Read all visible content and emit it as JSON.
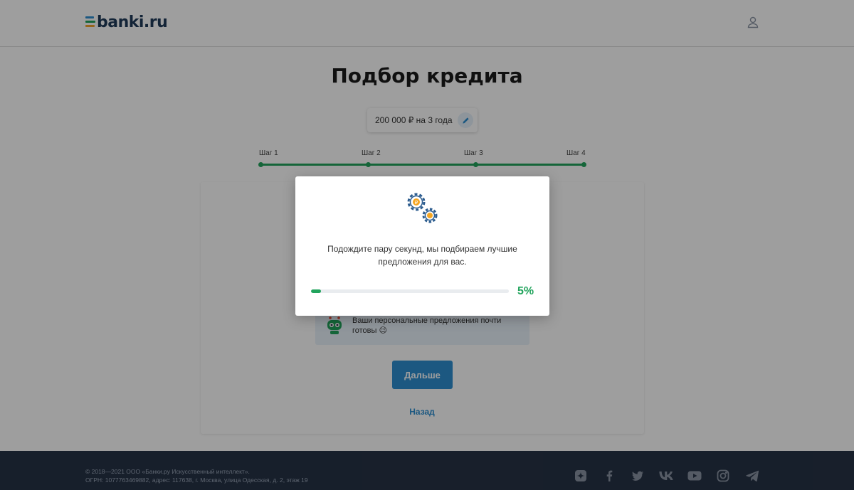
{
  "header": {
    "logo_text": "banki.ru",
    "user_icon": "user-icon"
  },
  "main": {
    "title": "Подбор кредита",
    "amount_chip": "200 000 ₽ на 3 года",
    "steps": [
      "Шаг 1",
      "Шаг 2",
      "Шаг 3",
      "Шаг 4"
    ],
    "robot_message": "Ваши персональные предложения почти готовы 😉",
    "next_button": "Дальше",
    "back_link": "Назад"
  },
  "modal": {
    "message": "Подождите пару секунд, мы подбираем лучшие предложения для вас.",
    "progress_label": "5%",
    "progress_value": 0.05,
    "icon": "gears-icon"
  },
  "footer": {
    "copyright": "© 2018—2021 ООО «Банки.ру Искусственный интеллект».",
    "address": "ОГРН: 1077763469882, адрес: 117638, г. Москва, улица Одесская, д. 2, этаж 19",
    "social": [
      "zen-icon",
      "facebook-icon",
      "twitter-icon",
      "vk-icon",
      "youtube-icon",
      "instagram-icon",
      "telegram-icon"
    ]
  },
  "colors": {
    "accent_green": "#22a45d",
    "accent_blue": "#2e8fd0",
    "footer_bg": "#263246"
  }
}
